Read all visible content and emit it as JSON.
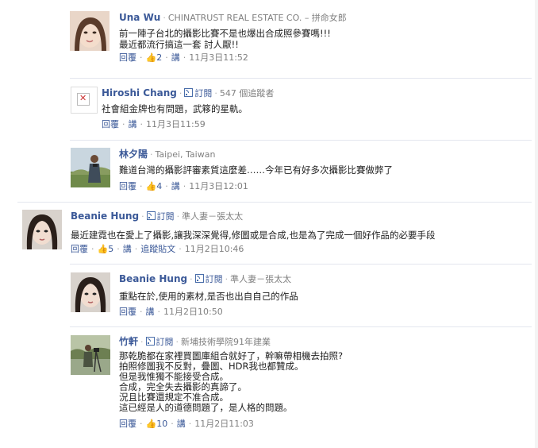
{
  "actions": {
    "reply": "回覆",
    "say": "講",
    "follow": "追蹤貼文",
    "subscribe": "訂閱",
    "like_glyph": "👍"
  },
  "comments": [
    {
      "name": "Una Wu",
      "meta": "CHINATRUST REAL ESTATE CO. – 拼命女郎",
      "text": "前一陣子台北的攝影比賽不是也爆出合成照參賽嗎!!!\n最近都流行搞這一套  討人厭!!",
      "likes": "2",
      "time": "11月3日11:52"
    },
    {
      "name": "Hiroshi Chang",
      "meta": "547 個追蹤者",
      "text": "社會組金牌也有問題，武簃的星軌。",
      "time": "11月3日11:59"
    },
    {
      "name": "林夕陽",
      "meta": "Taipei, Taiwan",
      "text": "難道台灣的攝影評審素質這麼差……今年已有好多次攝影比賽做弊了",
      "likes": "4",
      "time": "11月3日12:01"
    },
    {
      "name": "Beanie Hung",
      "meta": "準人妻－張太太",
      "text": "最近建霓也在愛上了攝影,讓我深深覺得,修圖或是合成,也是為了完成一個好作品的必要手段",
      "likes": "5",
      "time": "11月2日10:46"
    },
    {
      "name": "Beanie Hung",
      "meta": "準人妻－張太太",
      "text": "重點在於,使用的素材,是否也出自自己的作品",
      "time": "11月2日10:50"
    },
    {
      "name": "竹軒",
      "meta": "新埔技術學院91年建業",
      "text": "那乾脆都在家裡買圖庫組合就好了，幹嘛帶相機去拍照?\n拍照修圖我不反對，疊圖、HDR我也都贊成。\n但是我惟獨不能接受合成。\n合成，完全失去攝影的真諦了。\n況且比賽還規定不准合成。\n這已經是人的道德問題了，是人格的問題。",
      "likes": "10",
      "time": "11月2日11:03"
    }
  ]
}
